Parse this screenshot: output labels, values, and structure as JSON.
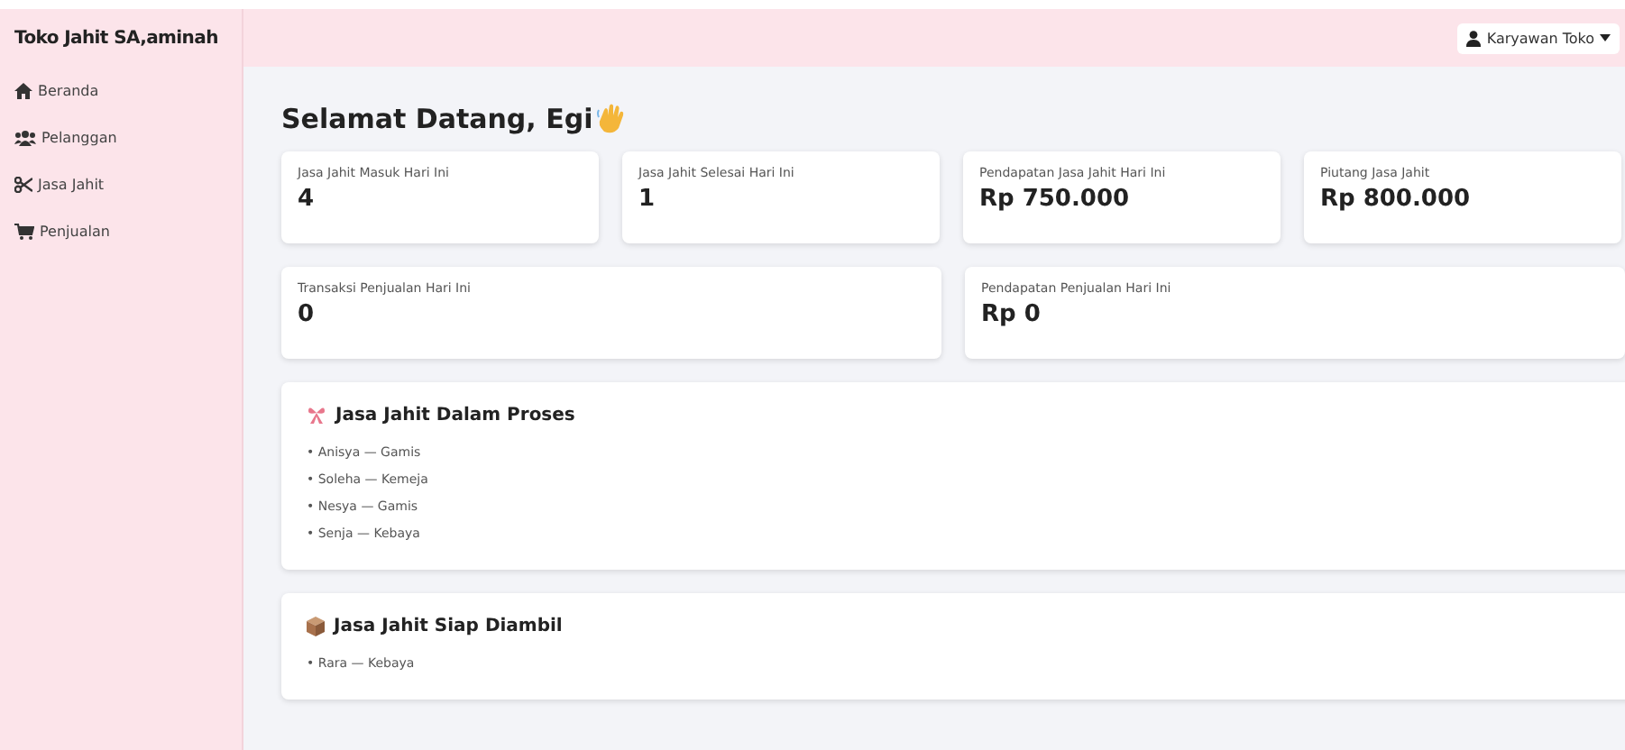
{
  "sidebar": {
    "brand": "Toko Jahit SA,aminah",
    "items": [
      {
        "label": "Beranda"
      },
      {
        "label": "Pelanggan"
      },
      {
        "label": "Jasa Jahit"
      },
      {
        "label": "Penjualan"
      }
    ]
  },
  "header": {
    "user_menu": "Karyawan Toko"
  },
  "greeting": "Selamat Datang, Egi",
  "stats": [
    {
      "label": "Jasa Jahit Masuk Hari Ini",
      "value": "4"
    },
    {
      "label": "Jasa Jahit Selesai Hari Ini",
      "value": "1"
    },
    {
      "label": "Pendapatan Jasa Jahit Hari Ini",
      "value": "Rp 750.000"
    },
    {
      "label": "Piutang Jasa Jahit",
      "value": "Rp 800.000"
    },
    {
      "label": "Transaksi Penjualan Hari Ini",
      "value": "0"
    },
    {
      "label": "Pendapatan Penjualan Hari Ini",
      "value": "Rp 0"
    }
  ],
  "panels": [
    {
      "title": "Jasa Jahit Dalam Proses",
      "items": [
        "• Anisya — Gamis",
        "• Soleha — Kemeja",
        "• Nesya — Gamis",
        "• Senja — Kebaya"
      ]
    },
    {
      "title": "Jasa Jahit Siap Diambil",
      "items": [
        "• Rara — Kebaya"
      ]
    }
  ]
}
